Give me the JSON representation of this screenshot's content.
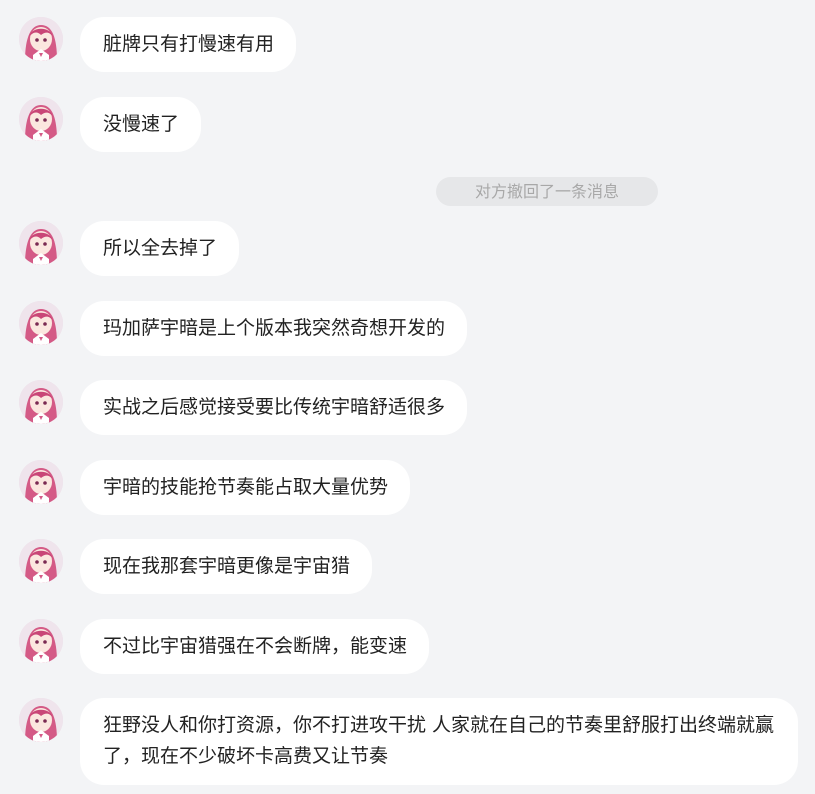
{
  "chat": {
    "messages": [
      {
        "text": "脏牌只有打慢速有用"
      },
      {
        "text": "没慢速了"
      },
      {
        "text": "所以全去掉了"
      },
      {
        "text": "玛加萨宇暗是上个版本我突然奇想开发的"
      },
      {
        "text": "实战之后感觉接受要比传统宇暗舒适很多"
      },
      {
        "text": "宇暗的技能抢节奏能占取大量优势"
      },
      {
        "text": "现在我那套宇暗更像是宇宙猎"
      },
      {
        "text": "不过比宇宙猎强在不会断牌，能变速"
      },
      {
        "text": "狂野没人和你打资源，你不打进攻干扰 人家就在自己的节奏里舒服打出终端就赢了，现在不少破坏卡高费又让节奏"
      }
    ],
    "system_notice": "对方撤回了一条消息"
  },
  "colors": {
    "background": "#f3f4f6",
    "bubble": "#ffffff",
    "text": "#222222",
    "system_bg": "#e6e7e9",
    "system_text": "#a8a8a8"
  },
  "icons": {
    "avatar": "anime-girl-pink-hair-avatar"
  }
}
